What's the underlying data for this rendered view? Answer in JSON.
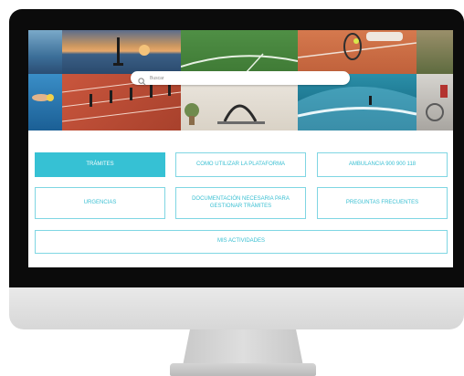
{
  "search": {
    "placeholder": "Buscar"
  },
  "buttons": {
    "tramites": "TRÁMITES",
    "como_utilizar": "COMO UTILIZAR LA PLATAFORMA",
    "ambulancia": "AMBULANCIA 900 900 118",
    "urgencias": "URGENCIAS",
    "documentacion": "DOCUMENTACIÓN NECESARIA PARA GESTIONAR TRÁMITES",
    "preguntas": "PREGUNTAS FRECUENTES",
    "mis_actividades": "MIS ACTIVIDADES"
  },
  "colors": {
    "accent": "#36c1d4",
    "border": "#7fd6e3",
    "bezel": "#0b0b0b"
  },
  "icons": {
    "search": "search-icon"
  }
}
